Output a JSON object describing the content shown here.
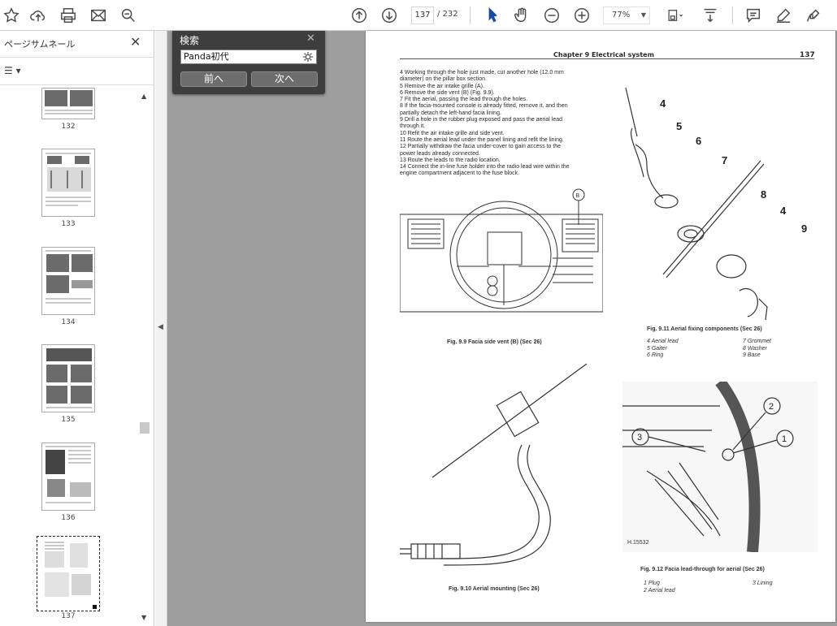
{
  "toolbar": {
    "current_page": "137",
    "total_pages": "/ 232",
    "zoom": "77%"
  },
  "sidebar": {
    "title": "ページサムネール",
    "close": "✕",
    "options": "☰ ▾",
    "thumbnails": [
      {
        "label": "132"
      },
      {
        "label": "133"
      },
      {
        "label": "134"
      },
      {
        "label": "135"
      },
      {
        "label": "136"
      },
      {
        "label": "137"
      }
    ]
  },
  "search": {
    "title": "検索",
    "close": "✕",
    "query": "Panda初代",
    "prev": "前へ",
    "next": "次へ"
  },
  "document": {
    "header": "Chapter 9  Electrical system",
    "page_number": "137",
    "body": [
      "4   Working through the hole just made, cut another hole (12.0 mm",
      "diameter) on the pillar box section.",
      "5   Remove the air intake grille (A).",
      "6   Remove the side vent (B) (Fig. 9.9).",
      "7   Fit the aerial, passing the lead through the holes.",
      "8   If the facia-mounted console is already fitted, remove it, and then",
      "partially detach the left-hand facia lining.",
      "9   Drill a hole in the rubber plug exposed and pass the aerial lead",
      "through it.",
      "10  Refit the air intake grille and side vent.",
      "11  Route the aerial lead under the panel lining and refit the lining.",
      "12  Partially withdraw the facia under-cover to gain access to the",
      "power leads already connected.",
      "13  Route the leads to the radio location.",
      "14  Connect the in-line fuse holder into the radio lead wire within the",
      "engine compartment adjacent to the fuse block."
    ],
    "fig99_caption": "Fig. 9.9 Facia side vent (B) (Sec 26)",
    "fig911_caption": "Fig. 9.11 Aerial fixing components (Sec 26)",
    "fig911_legend_left": [
      "4   Aerial lead",
      "5   Gaiter",
      "6   Ring"
    ],
    "fig911_legend_right": [
      "7   Grommet",
      "8   Washer",
      "9   Base"
    ],
    "fig910_caption": "Fig. 9.10 Aerial mounting (Sec 26)",
    "fig912_caption": "Fig. 9.12 Facia lead-through for aerial (Sec 26)",
    "fig912_legend_left": [
      "1   Plug",
      "2   Aerial lead"
    ],
    "fig912_legend_right": [
      "3   Lining"
    ],
    "fig912_ref": "H.15532",
    "callouts": {
      "c4": "4",
      "c5": "5",
      "c6": "6",
      "c7": "7",
      "c8": "8",
      "c4b": "4",
      "c9": "9",
      "b": "B",
      "n1": "1",
      "n2": "2",
      "n3": "3"
    }
  }
}
